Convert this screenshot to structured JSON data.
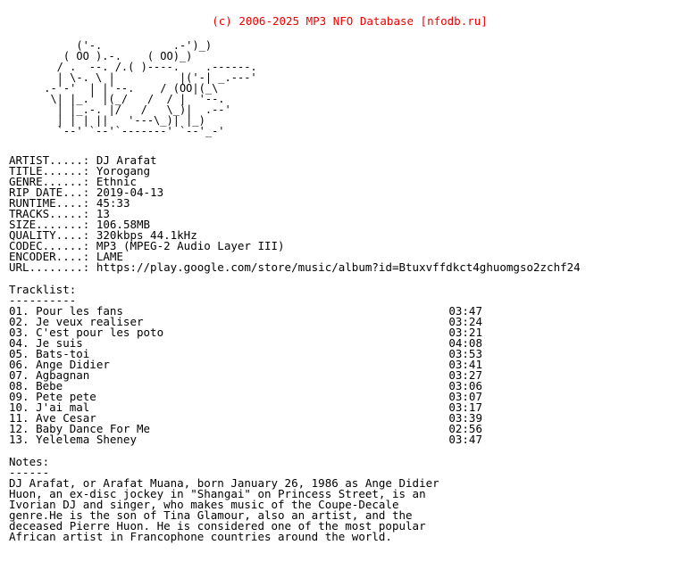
{
  "header": {
    "copyright": "(c) 2006-2025 MP3 NFO Database [nfodb.ru]",
    "accent_color": "#ee0000"
  },
  "logo": {
    "alt": "MUZA ascii art logo",
    "ascii": "      ('-.           .-')_)\n    ( OO ).-.    ( OO)_)\n   / .  --. /.( )----.    .------.\n   | \\-. \\ |          |('-| _.---'\n .-'-'  | |'--.    / (OO|(_\\\n  \\| |_.' |(_/   /  / |  '--.\n   | |_.-. |/   /   \\_)|  .--'\n   | | | ||   '---\\_)| |_)\n   `--' `--'`-------' `--'_-'"
  },
  "metadata": {
    "fields": [
      {
        "label": "ARTIST.....:",
        "value": "DJ Arafat"
      },
      {
        "label": "TITLE......:",
        "value": "Yorogang"
      },
      {
        "label": "GENRE......:",
        "value": "Ethnic"
      },
      {
        "label": "RIP DATE...:",
        "value": "2019-04-13"
      },
      {
        "label": "RUNTIME....:",
        "value": "45:33"
      },
      {
        "label": "TRACKS.....:",
        "value": "13"
      },
      {
        "label": "SIZE.......:",
        "value": "106.58MB"
      },
      {
        "label": "QUALITY....:",
        "value": "320kbps 44.1kHz"
      },
      {
        "label": "CODEC......:",
        "value": "MP3 (MPEG-2 Audio Layer III)"
      },
      {
        "label": "ENCODER....:",
        "value": "LAME"
      },
      {
        "label": "URL........:",
        "value": "https://play.google.com/store/music/album?id=Btuxvffdkct4ghuomgso2zchf24"
      }
    ]
  },
  "tracklist": {
    "heading": "Tracklist:",
    "underline": "----------",
    "tracks": [
      {
        "num": "01.",
        "title": "Pour les fans",
        "time": "03:47"
      },
      {
        "num": "02.",
        "title": "Je veux realiser",
        "time": "03:24"
      },
      {
        "num": "03.",
        "title": "C'est pour les poto",
        "time": "03:21"
      },
      {
        "num": "04.",
        "title": "Je suis",
        "time": "04:08"
      },
      {
        "num": "05.",
        "title": "Bats-toi",
        "time": "03:53"
      },
      {
        "num": "06.",
        "title": "Ange Didier",
        "time": "03:41"
      },
      {
        "num": "07.",
        "title": "Agbagnan",
        "time": "03:27"
      },
      {
        "num": "08.",
        "title": "Bebe",
        "time": "03:06"
      },
      {
        "num": "09.",
        "title": "Pete pete",
        "time": "03:07"
      },
      {
        "num": "10.",
        "title": "J'ai mal",
        "time": "03:17"
      },
      {
        "num": "11.",
        "title": "Ave Cesar",
        "time": "03:39"
      },
      {
        "num": "12.",
        "title": "Baby Dance For Me",
        "time": "02:56"
      },
      {
        "num": "13.",
        "title": "Yelelema Sheney",
        "time": "03:47"
      }
    ]
  },
  "notes": {
    "heading": "Notes:",
    "underline": "------",
    "lines": [
      "DJ Arafat, or Arafat Muana, born January 26, 1986 as Ange Didier",
      "Huon, an ex-disc jockey in \"Shangai\" on Princess Street, is an",
      "Ivorian DJ and singer, who makes music of the Coupe-Decale",
      "genre.He is the son of Tina Glamour, also an artist, and the",
      "deceased Pierre Huon. He is considered one of the most popular",
      "African artist in Francophone countries around the world."
    ]
  }
}
